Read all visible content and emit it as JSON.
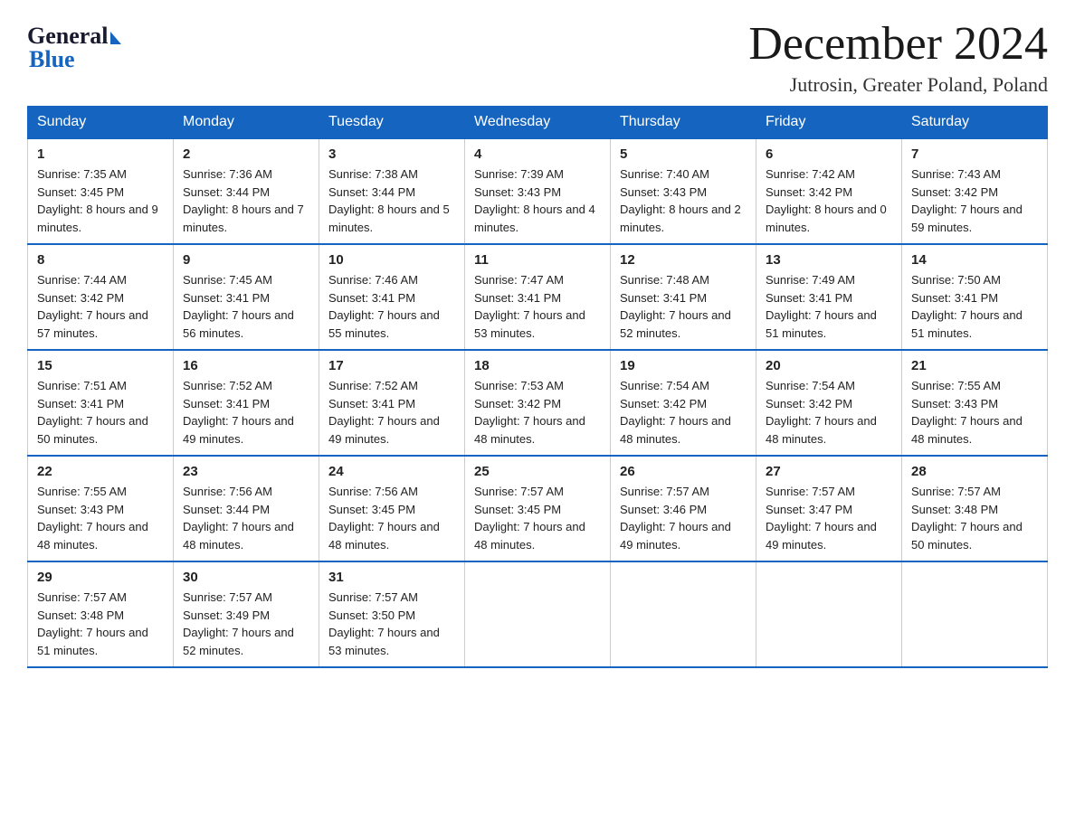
{
  "header": {
    "logo_general": "General",
    "logo_blue": "Blue",
    "month_title": "December 2024",
    "location": "Jutrosin, Greater Poland, Poland"
  },
  "days_of_week": [
    "Sunday",
    "Monday",
    "Tuesday",
    "Wednesday",
    "Thursday",
    "Friday",
    "Saturday"
  ],
  "weeks": [
    [
      {
        "num": "1",
        "sunrise": "7:35 AM",
        "sunset": "3:45 PM",
        "daylight": "8 hours and 9 minutes."
      },
      {
        "num": "2",
        "sunrise": "7:36 AM",
        "sunset": "3:44 PM",
        "daylight": "8 hours and 7 minutes."
      },
      {
        "num": "3",
        "sunrise": "7:38 AM",
        "sunset": "3:44 PM",
        "daylight": "8 hours and 5 minutes."
      },
      {
        "num": "4",
        "sunrise": "7:39 AM",
        "sunset": "3:43 PM",
        "daylight": "8 hours and 4 minutes."
      },
      {
        "num": "5",
        "sunrise": "7:40 AM",
        "sunset": "3:43 PM",
        "daylight": "8 hours and 2 minutes."
      },
      {
        "num": "6",
        "sunrise": "7:42 AM",
        "sunset": "3:42 PM",
        "daylight": "8 hours and 0 minutes."
      },
      {
        "num": "7",
        "sunrise": "7:43 AM",
        "sunset": "3:42 PM",
        "daylight": "7 hours and 59 minutes."
      }
    ],
    [
      {
        "num": "8",
        "sunrise": "7:44 AM",
        "sunset": "3:42 PM",
        "daylight": "7 hours and 57 minutes."
      },
      {
        "num": "9",
        "sunrise": "7:45 AM",
        "sunset": "3:41 PM",
        "daylight": "7 hours and 56 minutes."
      },
      {
        "num": "10",
        "sunrise": "7:46 AM",
        "sunset": "3:41 PM",
        "daylight": "7 hours and 55 minutes."
      },
      {
        "num": "11",
        "sunrise": "7:47 AM",
        "sunset": "3:41 PM",
        "daylight": "7 hours and 53 minutes."
      },
      {
        "num": "12",
        "sunrise": "7:48 AM",
        "sunset": "3:41 PM",
        "daylight": "7 hours and 52 minutes."
      },
      {
        "num": "13",
        "sunrise": "7:49 AM",
        "sunset": "3:41 PM",
        "daylight": "7 hours and 51 minutes."
      },
      {
        "num": "14",
        "sunrise": "7:50 AM",
        "sunset": "3:41 PM",
        "daylight": "7 hours and 51 minutes."
      }
    ],
    [
      {
        "num": "15",
        "sunrise": "7:51 AM",
        "sunset": "3:41 PM",
        "daylight": "7 hours and 50 minutes."
      },
      {
        "num": "16",
        "sunrise": "7:52 AM",
        "sunset": "3:41 PM",
        "daylight": "7 hours and 49 minutes."
      },
      {
        "num": "17",
        "sunrise": "7:52 AM",
        "sunset": "3:41 PM",
        "daylight": "7 hours and 49 minutes."
      },
      {
        "num": "18",
        "sunrise": "7:53 AM",
        "sunset": "3:42 PM",
        "daylight": "7 hours and 48 minutes."
      },
      {
        "num": "19",
        "sunrise": "7:54 AM",
        "sunset": "3:42 PM",
        "daylight": "7 hours and 48 minutes."
      },
      {
        "num": "20",
        "sunrise": "7:54 AM",
        "sunset": "3:42 PM",
        "daylight": "7 hours and 48 minutes."
      },
      {
        "num": "21",
        "sunrise": "7:55 AM",
        "sunset": "3:43 PM",
        "daylight": "7 hours and 48 minutes."
      }
    ],
    [
      {
        "num": "22",
        "sunrise": "7:55 AM",
        "sunset": "3:43 PM",
        "daylight": "7 hours and 48 minutes."
      },
      {
        "num": "23",
        "sunrise": "7:56 AM",
        "sunset": "3:44 PM",
        "daylight": "7 hours and 48 minutes."
      },
      {
        "num": "24",
        "sunrise": "7:56 AM",
        "sunset": "3:45 PM",
        "daylight": "7 hours and 48 minutes."
      },
      {
        "num": "25",
        "sunrise": "7:57 AM",
        "sunset": "3:45 PM",
        "daylight": "7 hours and 48 minutes."
      },
      {
        "num": "26",
        "sunrise": "7:57 AM",
        "sunset": "3:46 PM",
        "daylight": "7 hours and 49 minutes."
      },
      {
        "num": "27",
        "sunrise": "7:57 AM",
        "sunset": "3:47 PM",
        "daylight": "7 hours and 49 minutes."
      },
      {
        "num": "28",
        "sunrise": "7:57 AM",
        "sunset": "3:48 PM",
        "daylight": "7 hours and 50 minutes."
      }
    ],
    [
      {
        "num": "29",
        "sunrise": "7:57 AM",
        "sunset": "3:48 PM",
        "daylight": "7 hours and 51 minutes."
      },
      {
        "num": "30",
        "sunrise": "7:57 AM",
        "sunset": "3:49 PM",
        "daylight": "7 hours and 52 minutes."
      },
      {
        "num": "31",
        "sunrise": "7:57 AM",
        "sunset": "3:50 PM",
        "daylight": "7 hours and 53 minutes."
      },
      null,
      null,
      null,
      null
    ]
  ]
}
